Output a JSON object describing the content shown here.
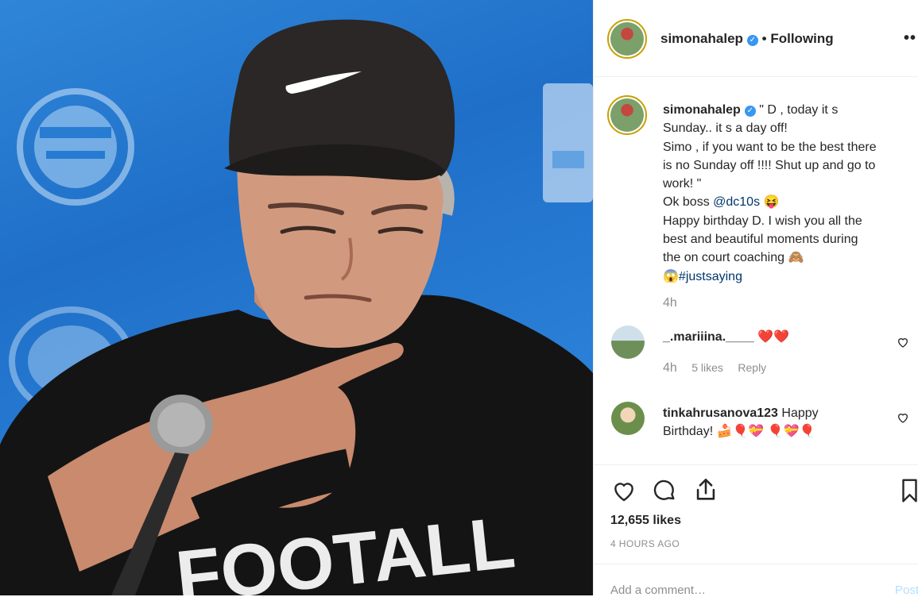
{
  "post": {
    "username": "simonahalep",
    "follow_status": "Following",
    "separator": "•",
    "more_icon": "more-dots-icon",
    "caption": {
      "line1": "\" D , today it s",
      "line2": "Sunday.. it s a day off!",
      "line3": "Simo , if you want to be the best there",
      "line4": "is no Sunday off !!!! Shut up and go to",
      "line5": "work! \"",
      "line6_prefix": "Ok boss ",
      "line6_mention": "@dc10s",
      "line6_emoji": "😝",
      "line7": "Happy birthday D. I wish you all the",
      "line8": "best and beautiful moments during",
      "line9_text": "the on court coaching ",
      "line9_emoji": "🙈",
      "line10_emoji": "😱",
      "line10_tag": "#justsaying",
      "age": "4h"
    },
    "comments": [
      {
        "username": "_.mariiina.____",
        "text": "❤️❤️",
        "age": "4h",
        "likes": "5 likes",
        "reply": "Reply"
      },
      {
        "username": "tinkahrusanova123",
        "text_line1": "Happy",
        "text_line2": "Birthday! 🍰🎈💝 🎈💝🎈"
      }
    ],
    "likes": "12,655 likes",
    "time_ago": "4 HOURS AGO",
    "comment_placeholder": "Add a comment…",
    "post_button": "Post"
  },
  "photo": {
    "shirt_text": "FOOTALL"
  },
  "colors": {
    "verified": "#3897f0",
    "link": "#00376b",
    "muted": "#8e8e8e",
    "photo_bg": "#2a7fd6"
  },
  "icons": [
    "heart-icon",
    "comment-icon",
    "share-icon",
    "bookmark-icon",
    "verified-badge-icon"
  ]
}
